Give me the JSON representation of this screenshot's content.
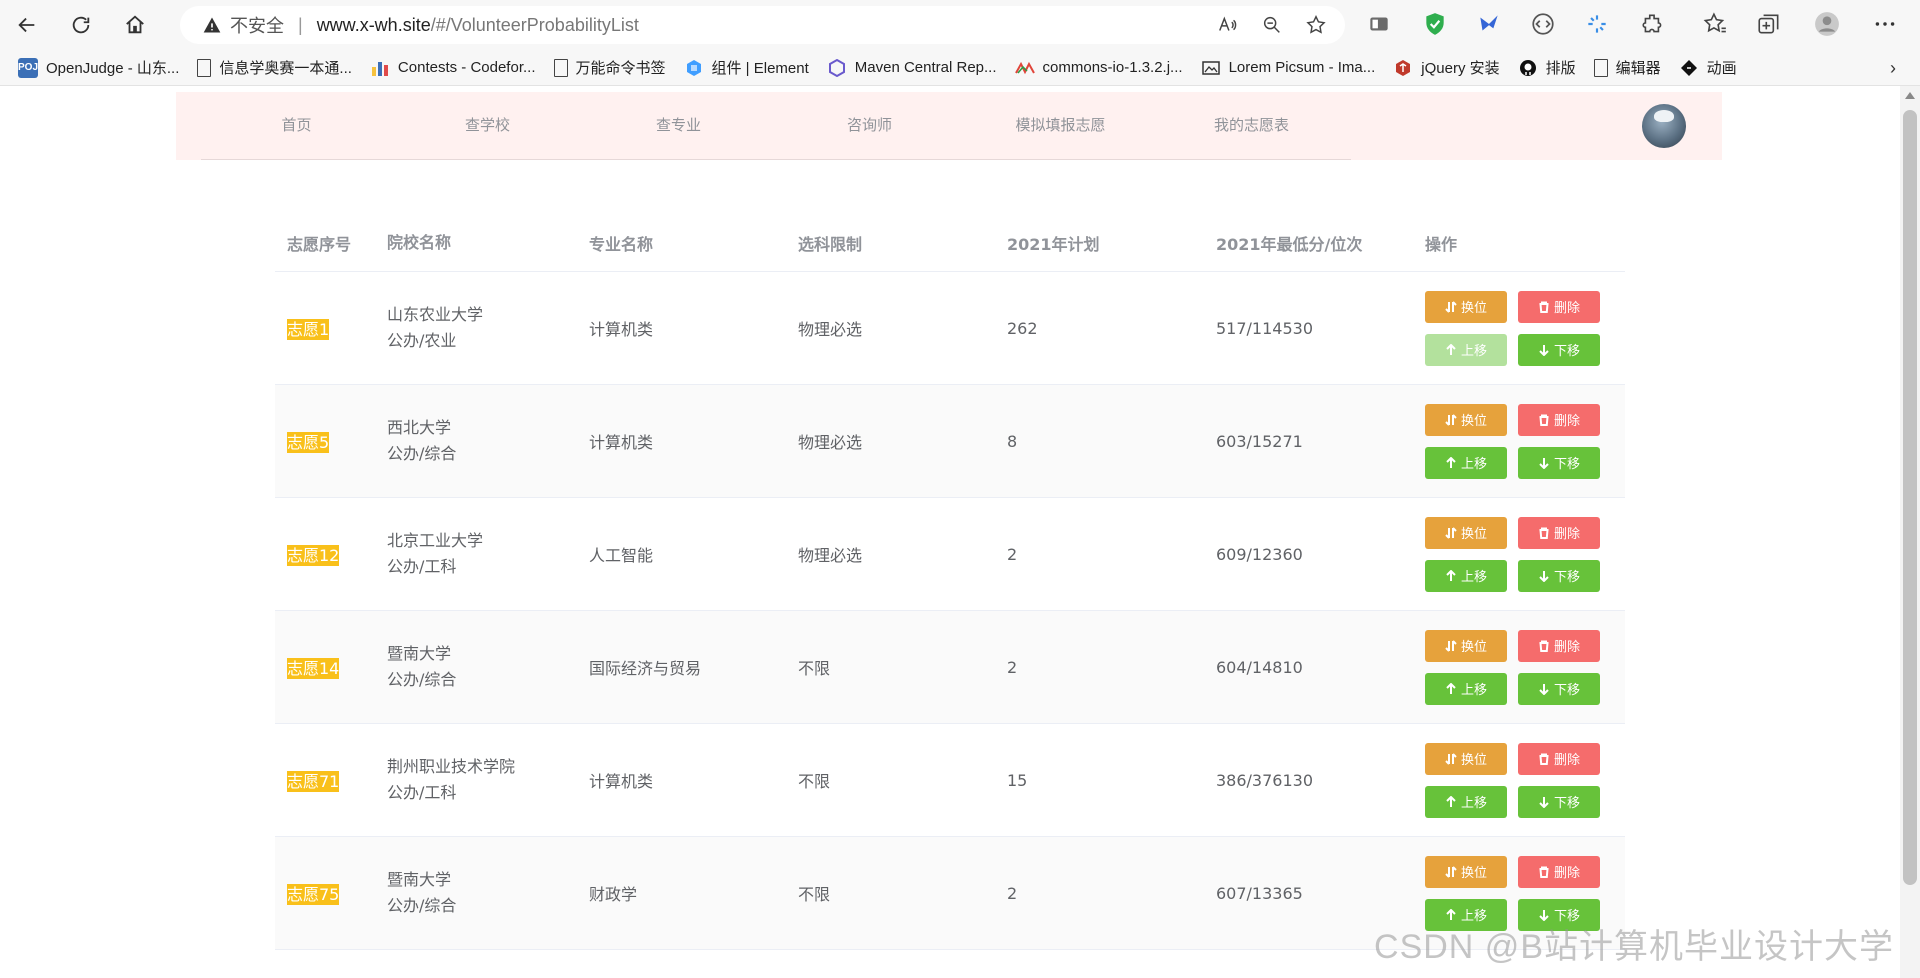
{
  "browser": {
    "address": {
      "insecure_label": "不安全",
      "url_host": "www.x-wh.site",
      "url_path": "/#/VolunteerProbabilityList"
    },
    "bookmarks": [
      {
        "label": "OpenJudge - 山东...",
        "icon": "poj-icon",
        "color": "#3b6fb6"
      },
      {
        "label": "信息学奥赛一本通...",
        "icon": "page-icon",
        "color": ""
      },
      {
        "label": "Contests - Codefor...",
        "icon": "bar-chart-icon",
        "color": ""
      },
      {
        "label": "万能命令书签",
        "icon": "page-icon",
        "color": ""
      },
      {
        "label": "组件 | Element",
        "icon": "element-icon",
        "color": "#409eff"
      },
      {
        "label": "Maven Central Rep...",
        "icon": "hexagon-icon",
        "color": "#6a5acd"
      },
      {
        "label": "commons-io-1.3.2.j...",
        "icon": "mvn-icon",
        "color": ""
      },
      {
        "label": "Lorem Picsum - Ima...",
        "icon": "image-icon",
        "color": ""
      },
      {
        "label": "jQuery 安装",
        "icon": "jquery-icon",
        "color": "#c0392b"
      },
      {
        "label": "排版",
        "icon": "github-icon",
        "color": "#111"
      },
      {
        "label": "编辑器",
        "icon": "page-icon",
        "color": ""
      },
      {
        "label": "动画",
        "icon": "diamond-icon",
        "color": "#111"
      }
    ]
  },
  "site": {
    "menu": [
      "首页",
      "查学校",
      "查专业",
      "咨询师",
      "模拟填报志愿",
      "我的志愿表"
    ]
  },
  "table": {
    "headers": [
      "志愿序号",
      "院校名称",
      "专业名称",
      "选科限制",
      "2021年计划",
      "2021年最低分/位次",
      "操作"
    ],
    "buttons": {
      "swap": "换位",
      "delete": "删除",
      "up": "上移",
      "down": "下移"
    },
    "rows": [
      {
        "rank": "志愿1",
        "school": "山东农业大学",
        "school_type": "公办/农业",
        "major": "计算机类",
        "subject": "物理必选",
        "plan": "262",
        "score": "517/114530",
        "up_disabled": true
      },
      {
        "rank": "志愿5",
        "school": "西北大学",
        "school_type": "公办/综合",
        "major": "计算机类",
        "subject": "物理必选",
        "plan": "8",
        "score": "603/15271",
        "up_disabled": false
      },
      {
        "rank": "志愿12",
        "school": "北京工业大学",
        "school_type": "公办/工科",
        "major": "人工智能",
        "subject": "物理必选",
        "plan": "2",
        "score": "609/12360",
        "up_disabled": false
      },
      {
        "rank": "志愿14",
        "school": "暨南大学",
        "school_type": "公办/综合",
        "major": "国际经济与贸易",
        "subject": "不限",
        "plan": "2",
        "score": "604/14810",
        "up_disabled": false
      },
      {
        "rank": "志愿71",
        "school": "荆州职业技术学院",
        "school_type": "公办/工科",
        "major": "计算机类",
        "subject": "不限",
        "plan": "15",
        "score": "386/376130",
        "up_disabled": false
      },
      {
        "rank": "志愿75",
        "school": "暨南大学",
        "school_type": "公办/综合",
        "major": "财政学",
        "subject": "不限",
        "plan": "2",
        "score": "607/13365",
        "up_disabled": false
      }
    ]
  },
  "watermark": "CSDN @B站计算机毕业设计大学"
}
